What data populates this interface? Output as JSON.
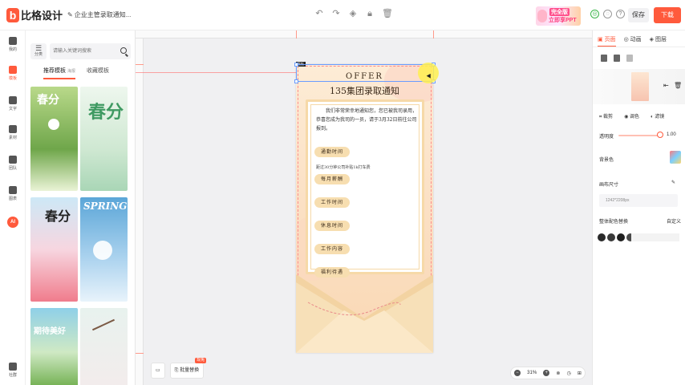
{
  "app": {
    "logo_letter": "b",
    "logo_text": "比格设计",
    "doc_title": "企业主管录取通知...",
    "promo_line1": "完全版",
    "promo_line2": "立即享PPT",
    "save_label": "保存",
    "download_label": "下载"
  },
  "rail": [
    {
      "label": "我的"
    },
    {
      "label": "模板"
    },
    {
      "label": "文字"
    },
    {
      "label": "素材"
    },
    {
      "label": "团队"
    },
    {
      "label": "图表"
    },
    {
      "label": "AI"
    },
    {
      "label": "社群"
    }
  ],
  "templates": {
    "category_label": "分类",
    "search_placeholder": "请输入关键词搜索",
    "tab_recommended": "推荐模板",
    "tab_recommended_sub": "海报",
    "tab_favorites": "收藏模板",
    "thumb_texts": [
      "春分",
      "春分",
      "春分",
      "SPRING",
      "期待美好",
      ""
    ]
  },
  "poster": {
    "tag": "画板",
    "offer": "OFFER",
    "title": "135集团录取通知",
    "intro": "我们非常荣幸地通知您，您已被我司录用，恭喜您成为我司的一员，请于3月32日前往公司报到。",
    "commute_label": "通勤时间",
    "commute_text": "距过30分钟公司补贴1k打车费",
    "salary_label": "每月薪酬",
    "work_time_label": "工作时间",
    "rest_time_label": "休息时间",
    "work_content_label": "工作内容",
    "benefits_label": "福利待遇"
  },
  "bottom": {
    "batch_replace": "批量替换",
    "new_badge": "现免",
    "zoom": "31%"
  },
  "right_panel": {
    "tab_page": "页面",
    "tab_animation": "动画",
    "tab_layers": "图层",
    "crop": "裁剪",
    "color_adjust": "调色",
    "filter": "滤镜",
    "opacity_label": "透明度",
    "opacity_value": "1.00",
    "background_label": "背景色",
    "canvas_size_label": "画布尺寸",
    "canvas_size_value": "1242*2208px",
    "palette_label": "整体配色替换",
    "custom_label": "自定义",
    "palette_colors": [
      "#2a2a2a",
      "#3a3a3a",
      "#1f1f1f",
      "#4a4a4a"
    ]
  }
}
